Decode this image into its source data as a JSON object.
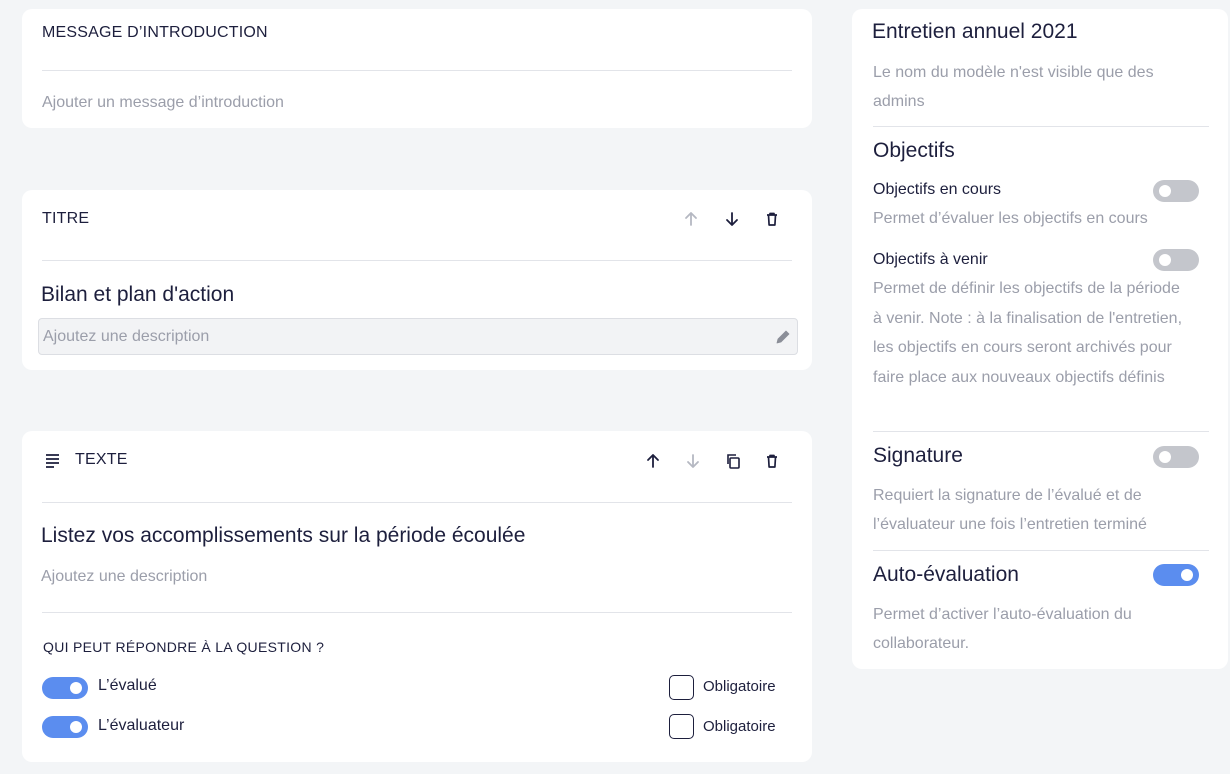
{
  "intro_card": {
    "header": "MESSAGE D’INTRODUCTION",
    "placeholder": "Ajouter un message d’introduction"
  },
  "title_card": {
    "header": "TITRE",
    "title": "Bilan et plan d'action",
    "description_placeholder": "Ajoutez une description",
    "icons": [
      "arrow-up-icon",
      "arrow-down-icon",
      "trash-icon",
      "pencil-icon"
    ]
  },
  "text_card": {
    "header": "TEXTE",
    "question": "Listez vos accomplissements sur la période écoulée",
    "description_placeholder": "Ajoutez une description",
    "respondents_heading": "QUI PEUT RÉPONDRE À LA QUESTION ?",
    "respondents": [
      {
        "label": "L’évalué",
        "enabled": true,
        "required_label": "Obligatoire",
        "required": false
      },
      {
        "label": "L’évaluateur",
        "enabled": true,
        "required_label": "Obligatoire",
        "required": false
      }
    ],
    "icons": [
      "text-lines-icon",
      "arrow-up-icon",
      "arrow-down-icon",
      "copy-icon",
      "trash-icon"
    ]
  },
  "sidebar": {
    "template_name": "Entretien annuel 2021",
    "template_note": "Le nom du modèle n'est visible que des admins",
    "objectives_heading": "Objectifs",
    "current_objectives": {
      "label": "Objectifs en cours",
      "description": "Permet d’évaluer les objectifs en cours",
      "enabled": false
    },
    "future_objectives": {
      "label": "Objectifs à venir",
      "description": "Permet de définir les objectifs de la période à venir. Note : à la finalisation de l'entretien, les objectifs en cours seront archivés pour faire place aux nouveaux objectifs définis",
      "enabled": false
    },
    "signature": {
      "label": "Signature",
      "description": "Requiert la signature de l’évalué et de l’évaluateur une fois l’entretien terminé",
      "enabled": false
    },
    "self_evaluation": {
      "label": "Auto-évaluation",
      "description": "Permet d’activer l’auto-évaluation du collaborateur.",
      "enabled": true
    }
  },
  "colors": {
    "background": "#f3f5f7",
    "card": "#ffffff",
    "text": "#1d1f3d",
    "muted": "#9b9eaa",
    "toggle_on": "#5b8def",
    "toggle_off": "#c4c6cc"
  }
}
